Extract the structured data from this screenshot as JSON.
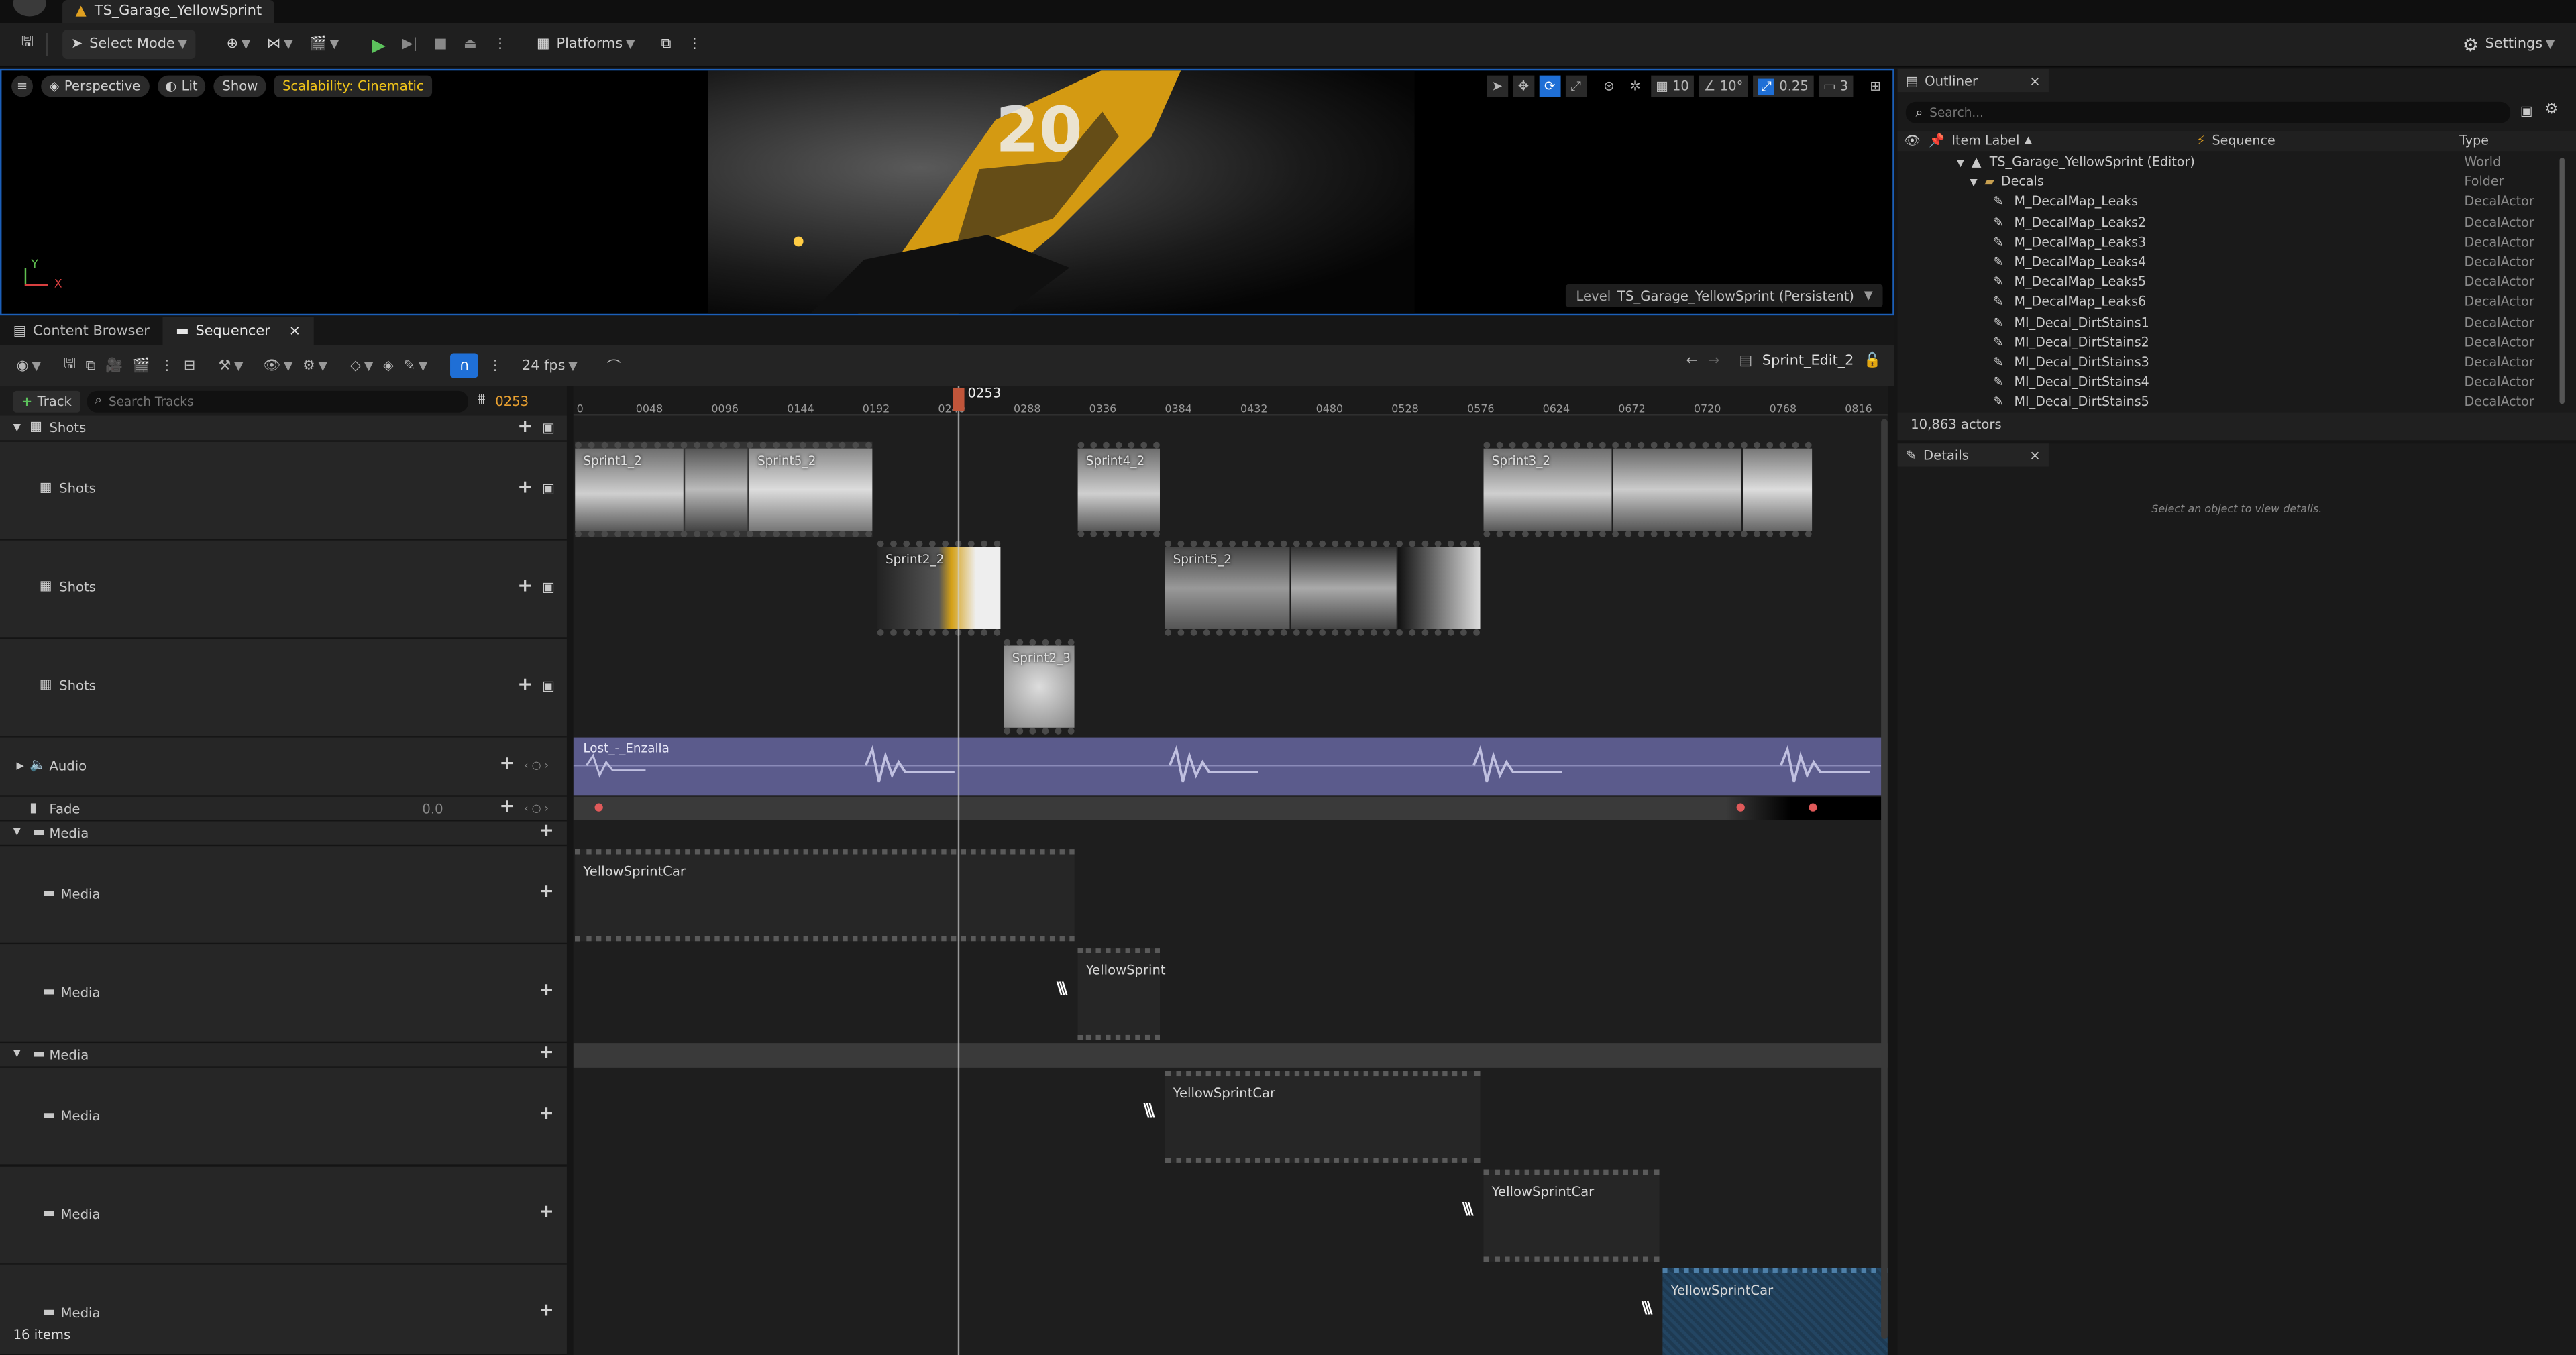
{
  "window": {
    "level_tab": "TS_Garage_YellowSprint"
  },
  "toolbar": {
    "select_mode": "Select Mode",
    "platforms": "Platforms",
    "settings": "Settings"
  },
  "viewport": {
    "perspective": "Perspective",
    "lit": "Lit",
    "show": "Show",
    "scalability": "Scalability: Cinematic",
    "grid": "10",
    "angle": "10°",
    "scale": "0.25",
    "camera": "3",
    "level_label": "Level",
    "level_name": "TS_Garage_YellowSprint (Persistent)",
    "axis_x": "X",
    "axis_y": "Y",
    "car_number": "20"
  },
  "tabs": {
    "content_browser": "Content Browser",
    "sequencer": "Sequencer"
  },
  "seq_toolbar": {
    "fps": "24 fps",
    "sequence_name": "Sprint_Edit_2"
  },
  "sequencer": {
    "add_track": "Track",
    "search_placeholder": "Search Tracks",
    "current_frame": "0253",
    "playhead": "0253",
    "fade_value": "0.0",
    "item_count": "16 items",
    "ruler": [
      "0",
      "0048",
      "0096",
      "0144",
      "0192",
      "0240",
      "0288",
      "0336",
      "0384",
      "0432",
      "0480",
      "0528",
      "0576",
      "0624",
      "0672",
      "0720",
      "0768",
      "0816"
    ]
  },
  "tracks": {
    "shots": "Shots",
    "sub_shots": "Shots",
    "audio": "Audio",
    "fade": "Fade",
    "media": "Media",
    "sub_media": "Media",
    "audio_clip": "Lost_-_Enzalla"
  },
  "shot_clips": [
    {
      "name": "Sprint1_2"
    },
    {
      "name": "Sprint5_2"
    },
    {
      "name": "Sprint4_2"
    },
    {
      "name": "Sprint3_2"
    },
    {
      "name": "Sprint2_2"
    },
    {
      "name": "Sprint5_2"
    },
    {
      "name": "Sprint2_3"
    }
  ],
  "media_clips": [
    "YellowSprintCar",
    "YellowSprint",
    "YellowSprintCar",
    "YellowSprintCar",
    "YellowSprintCar"
  ],
  "outliner": {
    "title": "Outliner",
    "search_placeholder": "Search...",
    "col_label": "Item Label",
    "col_sequence": "Sequence",
    "col_type": "Type",
    "actor_count": "10,863 actors",
    "rows": [
      {
        "label": "TS_Garage_YellowSprint (Editor)",
        "type": "World"
      },
      {
        "label": "Decals",
        "type": "Folder"
      },
      {
        "label": "M_DecalMap_Leaks",
        "type": "DecalActor"
      },
      {
        "label": "M_DecalMap_Leaks2",
        "type": "DecalActor"
      },
      {
        "label": "M_DecalMap_Leaks3",
        "type": "DecalActor"
      },
      {
        "label": "M_DecalMap_Leaks4",
        "type": "DecalActor"
      },
      {
        "label": "M_DecalMap_Leaks5",
        "type": "DecalActor"
      },
      {
        "label": "M_DecalMap_Leaks6",
        "type": "DecalActor"
      },
      {
        "label": "MI_Decal_DirtStains1",
        "type": "DecalActor"
      },
      {
        "label": "MI_Decal_DirtStains2",
        "type": "DecalActor"
      },
      {
        "label": "MI_Decal_DirtStains3",
        "type": "DecalActor"
      },
      {
        "label": "MI_Decal_DirtStains4",
        "type": "DecalActor"
      },
      {
        "label": "MI_Decal_DirtStains5",
        "type": "DecalActor"
      }
    ]
  },
  "details": {
    "title": "Details",
    "empty": "Select an object to view details."
  }
}
